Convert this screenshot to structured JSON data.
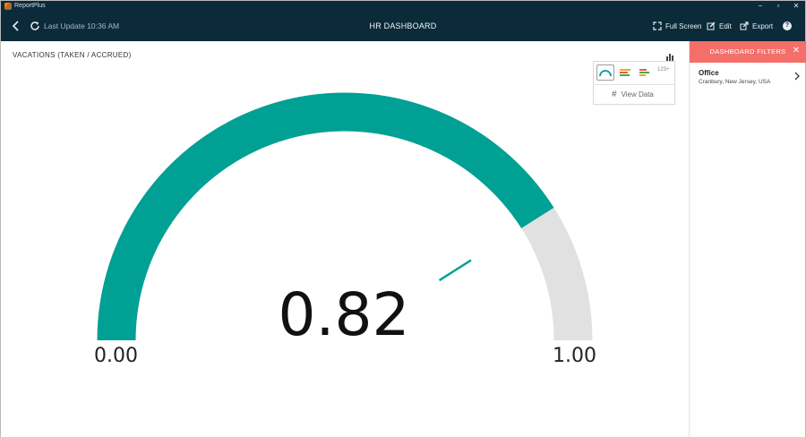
{
  "window": {
    "app_name": "ReportPlus",
    "controls": {
      "minimize": "−",
      "maximize": "▫",
      "close": "✕"
    }
  },
  "header": {
    "last_update": "Last Update 10:36 AM",
    "title": "HR DASHBOARD",
    "actions": {
      "full_screen": "Full Screen",
      "edit": "Edit",
      "export": "Export",
      "help": "?"
    }
  },
  "widget": {
    "title": "VACATIONS (TAKEN / ACCRUED)",
    "visualizations": {
      "numeric_label": "123+",
      "view_data": "View Data",
      "view_data_icon": "#"
    },
    "gauge": {
      "value": 0.82,
      "value_label": "0.82",
      "min": 0,
      "max": 1,
      "min_label": "0.00",
      "max_label": "1.00",
      "target_fraction": 0.82,
      "fill_color": "#00a094",
      "track_color": "#e1e1e1",
      "needle_color": "#00a094"
    }
  },
  "filters": {
    "header": "DASHBOARD FILTERS",
    "close_icon": "✕",
    "items": [
      {
        "name": "Office",
        "value": "Cranbury, New Jersey, USA"
      }
    ]
  },
  "colors": {
    "appbar": "#0b2b3b",
    "accent": "#00a094",
    "filters_header": "#f46f6a"
  }
}
